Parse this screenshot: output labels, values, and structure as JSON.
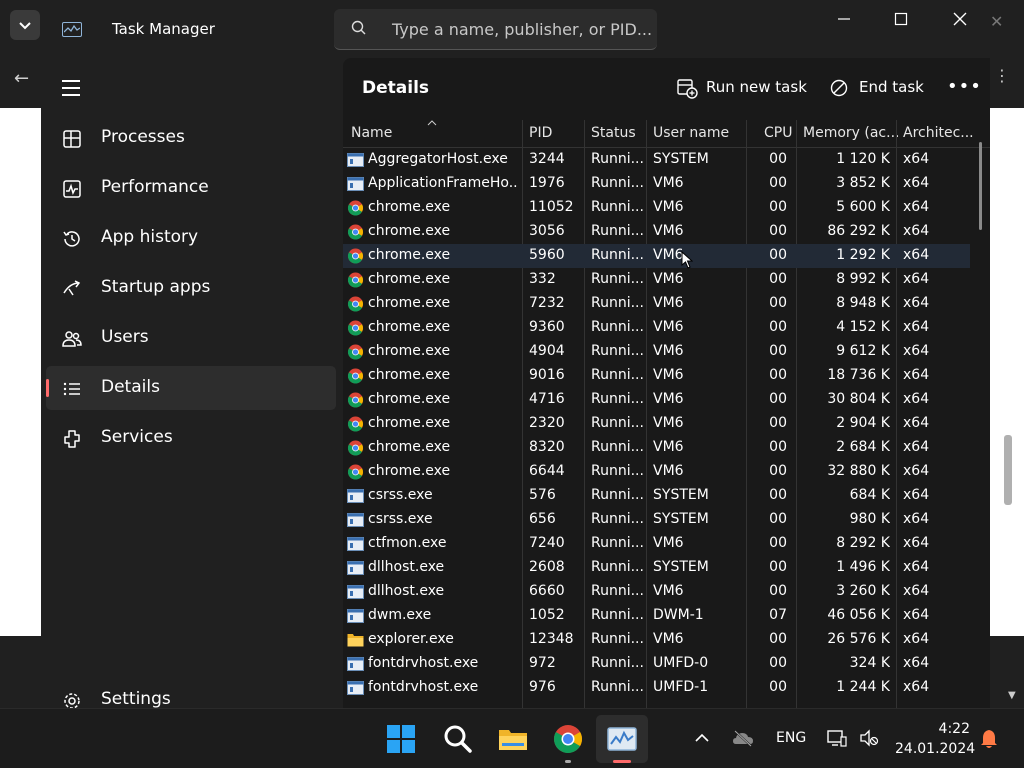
{
  "window": {
    "title": "Task Manager",
    "search_placeholder": "Type a name, publisher, or PID...",
    "minimize": "—",
    "maximize": "☐",
    "close": "✕"
  },
  "sidebar": {
    "items": [
      {
        "label": "Processes",
        "icon": "processes-icon"
      },
      {
        "label": "Performance",
        "icon": "performance-icon"
      },
      {
        "label": "App history",
        "icon": "app-history-icon"
      },
      {
        "label": "Startup apps",
        "icon": "startup-apps-icon"
      },
      {
        "label": "Users",
        "icon": "users-icon"
      },
      {
        "label": "Details",
        "icon": "details-icon",
        "active": true
      },
      {
        "label": "Services",
        "icon": "services-icon"
      }
    ],
    "settings": "Settings"
  },
  "page": {
    "title": "Details",
    "run_new_task": "Run new task",
    "end_task": "End task",
    "more": "•••"
  },
  "table": {
    "columns": [
      "Name",
      "PID",
      "Status",
      "User name",
      "CPU",
      "Memory (ac...",
      "Architec..."
    ],
    "rows": [
      {
        "icon": "window",
        "name": "AggregatorHost.exe",
        "pid": "3244",
        "status": "Runni...",
        "user": "SYSTEM",
        "cpu": "00",
        "mem": "1 120 K",
        "arch": "x64"
      },
      {
        "icon": "window",
        "name": "ApplicationFrameHo...",
        "pid": "1976",
        "status": "Runni...",
        "user": "VM6",
        "cpu": "00",
        "mem": "3 852 K",
        "arch": "x64"
      },
      {
        "icon": "chrome",
        "name": "chrome.exe",
        "pid": "11052",
        "status": "Runni...",
        "user": "VM6",
        "cpu": "00",
        "mem": "5 600 K",
        "arch": "x64"
      },
      {
        "icon": "chrome",
        "name": "chrome.exe",
        "pid": "3056",
        "status": "Runni...",
        "user": "VM6",
        "cpu": "00",
        "mem": "86 292 K",
        "arch": "x64"
      },
      {
        "icon": "chrome",
        "name": "chrome.exe",
        "pid": "5960",
        "status": "Runni...",
        "user": "VM6",
        "cpu": "00",
        "mem": "1 292 K",
        "arch": "x64",
        "selected": true
      },
      {
        "icon": "chrome",
        "name": "chrome.exe",
        "pid": "332",
        "status": "Runni...",
        "user": "VM6",
        "cpu": "00",
        "mem": "8 992 K",
        "arch": "x64"
      },
      {
        "icon": "chrome",
        "name": "chrome.exe",
        "pid": "7232",
        "status": "Runni...",
        "user": "VM6",
        "cpu": "00",
        "mem": "8 948 K",
        "arch": "x64"
      },
      {
        "icon": "chrome",
        "name": "chrome.exe",
        "pid": "9360",
        "status": "Runni...",
        "user": "VM6",
        "cpu": "00",
        "mem": "4 152 K",
        "arch": "x64"
      },
      {
        "icon": "chrome",
        "name": "chrome.exe",
        "pid": "4904",
        "status": "Runni...",
        "user": "VM6",
        "cpu": "00",
        "mem": "9 612 K",
        "arch": "x64"
      },
      {
        "icon": "chrome",
        "name": "chrome.exe",
        "pid": "9016",
        "status": "Runni...",
        "user": "VM6",
        "cpu": "00",
        "mem": "18 736 K",
        "arch": "x64"
      },
      {
        "icon": "chrome",
        "name": "chrome.exe",
        "pid": "4716",
        "status": "Runni...",
        "user": "VM6",
        "cpu": "00",
        "mem": "30 804 K",
        "arch": "x64"
      },
      {
        "icon": "chrome",
        "name": "chrome.exe",
        "pid": "2320",
        "status": "Runni...",
        "user": "VM6",
        "cpu": "00",
        "mem": "2 904 K",
        "arch": "x64"
      },
      {
        "icon": "chrome",
        "name": "chrome.exe",
        "pid": "8320",
        "status": "Runni...",
        "user": "VM6",
        "cpu": "00",
        "mem": "2 684 K",
        "arch": "x64"
      },
      {
        "icon": "chrome",
        "name": "chrome.exe",
        "pid": "6644",
        "status": "Runni...",
        "user": "VM6",
        "cpu": "00",
        "mem": "32 880 K",
        "arch": "x64"
      },
      {
        "icon": "window",
        "name": "csrss.exe",
        "pid": "576",
        "status": "Runni...",
        "user": "SYSTEM",
        "cpu": "00",
        "mem": "684 K",
        "arch": "x64"
      },
      {
        "icon": "window",
        "name": "csrss.exe",
        "pid": "656",
        "status": "Runni...",
        "user": "SYSTEM",
        "cpu": "00",
        "mem": "980 K",
        "arch": "x64"
      },
      {
        "icon": "window",
        "name": "ctfmon.exe",
        "pid": "7240",
        "status": "Runni...",
        "user": "VM6",
        "cpu": "00",
        "mem": "8 292 K",
        "arch": "x64"
      },
      {
        "icon": "window",
        "name": "dllhost.exe",
        "pid": "2608",
        "status": "Runni...",
        "user": "SYSTEM",
        "cpu": "00",
        "mem": "1 496 K",
        "arch": "x64"
      },
      {
        "icon": "window",
        "name": "dllhost.exe",
        "pid": "6660",
        "status": "Runni...",
        "user": "VM6",
        "cpu": "00",
        "mem": "3 260 K",
        "arch": "x64"
      },
      {
        "icon": "window",
        "name": "dwm.exe",
        "pid": "1052",
        "status": "Runni...",
        "user": "DWM-1",
        "cpu": "07",
        "mem": "46 056 K",
        "arch": "x64"
      },
      {
        "icon": "folder",
        "name": "explorer.exe",
        "pid": "12348",
        "status": "Runni...",
        "user": "VM6",
        "cpu": "00",
        "mem": "26 576 K",
        "arch": "x64"
      },
      {
        "icon": "window",
        "name": "fontdrvhost.exe",
        "pid": "972",
        "status": "Runni...",
        "user": "UMFD-0",
        "cpu": "00",
        "mem": "324 K",
        "arch": "x64"
      },
      {
        "icon": "window",
        "name": "fontdrvhost.exe",
        "pid": "976",
        "status": "Runni...",
        "user": "UMFD-1",
        "cpu": "00",
        "mem": "1 244 K",
        "arch": "x64"
      }
    ]
  },
  "taskbar": {
    "lang": "ENG",
    "time": "4:22",
    "date": "24.01.2024"
  }
}
